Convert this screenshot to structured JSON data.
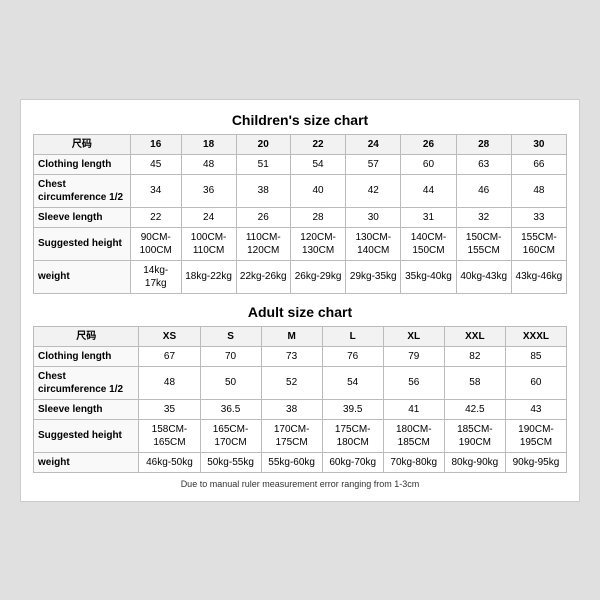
{
  "children_chart": {
    "title": "Children's size chart",
    "columns": [
      "尺码",
      "16",
      "18",
      "20",
      "22",
      "24",
      "26",
      "28",
      "30"
    ],
    "rows": [
      {
        "label": "Clothing length",
        "values": [
          "45",
          "48",
          "51",
          "54",
          "57",
          "60",
          "63",
          "66"
        ]
      },
      {
        "label": "Chest circumference 1/2",
        "values": [
          "34",
          "36",
          "38",
          "40",
          "42",
          "44",
          "46",
          "48"
        ]
      },
      {
        "label": "Sleeve length",
        "values": [
          "22",
          "24",
          "26",
          "28",
          "30",
          "31",
          "32",
          "33"
        ]
      },
      {
        "label": "Suggested height",
        "values": [
          "90CM-100CM",
          "100CM-110CM",
          "110CM-120CM",
          "120CM-130CM",
          "130CM-140CM",
          "140CM-150CM",
          "150CM-155CM",
          "155CM-160CM"
        ]
      },
      {
        "label": "weight",
        "values": [
          "14kg-17kg",
          "18kg-22kg",
          "22kg-26kg",
          "26kg-29kg",
          "29kg-35kg",
          "35kg-40kg",
          "40kg-43kg",
          "43kg-46kg"
        ]
      }
    ]
  },
  "adult_chart": {
    "title": "Adult size chart",
    "columns": [
      "尺码",
      "XS",
      "S",
      "M",
      "L",
      "XL",
      "XXL",
      "XXXL"
    ],
    "rows": [
      {
        "label": "Clothing length",
        "values": [
          "67",
          "70",
          "73",
          "76",
          "79",
          "82",
          "85"
        ]
      },
      {
        "label": "Chest circumference 1/2",
        "values": [
          "48",
          "50",
          "52",
          "54",
          "56",
          "58",
          "60"
        ]
      },
      {
        "label": "Sleeve length",
        "values": [
          "35",
          "36.5",
          "38",
          "39.5",
          "41",
          "42.5",
          "43"
        ]
      },
      {
        "label": "Suggested height",
        "values": [
          "158CM-165CM",
          "165CM-170CM",
          "170CM-175CM",
          "175CM-180CM",
          "180CM-185CM",
          "185CM-190CM",
          "190CM-195CM"
        ]
      },
      {
        "label": "weight",
        "values": [
          "46kg-50kg",
          "50kg-55kg",
          "55kg-60kg",
          "60kg-70kg",
          "70kg-80kg",
          "80kg-90kg",
          "90kg-95kg"
        ]
      }
    ]
  },
  "footer_note": "Due to manual ruler measurement error ranging from 1-3cm"
}
